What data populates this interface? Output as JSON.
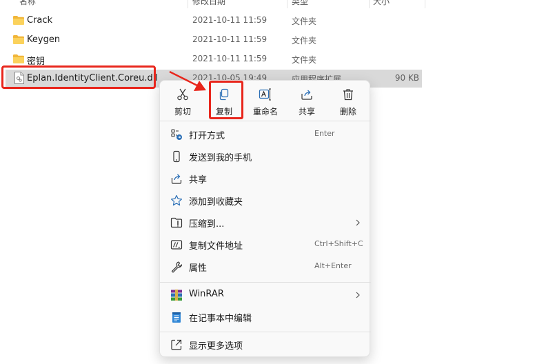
{
  "columns": {
    "name": "名称",
    "date": "修改日期",
    "type": "类型",
    "size": "大小"
  },
  "files": [
    {
      "name": "Crack",
      "date": "2021-10-11 11:59",
      "type": "文件夹",
      "size": "",
      "kind": "folder"
    },
    {
      "name": "Keygen",
      "date": "2021-10-11 11:59",
      "type": "文件夹",
      "size": "",
      "kind": "folder"
    },
    {
      "name": "密钥",
      "date": "2021-10-11 11:59",
      "type": "文件夹",
      "size": "",
      "kind": "folder"
    },
    {
      "name": "Eplan.IdentityClient.Coreu.dll",
      "date": "2021-10-05 19:49",
      "type": "应用程序扩展",
      "size": "90 KB",
      "kind": "dll",
      "selected": true
    }
  ],
  "context_menu": {
    "quick_actions": [
      {
        "label": "剪切",
        "icon": "scissors-icon"
      },
      {
        "label": "复制",
        "icon": "copy-icon"
      },
      {
        "label": "重命名",
        "icon": "rename-icon"
      },
      {
        "label": "共享",
        "icon": "share-icon"
      },
      {
        "label": "删除",
        "icon": "trash-icon"
      }
    ],
    "items": [
      {
        "label": "打开方式",
        "shortcut": "Enter",
        "icon": "open-with-icon"
      },
      {
        "label": "发送到我的手机",
        "shortcut": "",
        "icon": "phone-icon"
      },
      {
        "label": "共享",
        "shortcut": "",
        "icon": "share-icon"
      },
      {
        "label": "添加到收藏夹",
        "shortcut": "",
        "icon": "star-icon"
      },
      {
        "label": "压缩到...",
        "shortcut": "",
        "icon": "zip-folder-icon",
        "submenu": true
      },
      {
        "label": "复制文件地址",
        "shortcut": "Ctrl+Shift+C",
        "icon": "copy-path-icon"
      },
      {
        "label": "属性",
        "shortcut": "Alt+Enter",
        "icon": "wrench-icon"
      },
      {
        "label": "WinRAR",
        "shortcut": "",
        "icon": "winrar-icon",
        "submenu": true
      },
      {
        "label": "在记事本中编辑",
        "shortcut": "",
        "icon": "notepad-icon"
      },
      {
        "label": "显示更多选项",
        "shortcut": "",
        "icon": "show-more-icon"
      }
    ]
  },
  "colors": {
    "highlight_red": "#e8261c",
    "selection_gray": "#d9d9d9",
    "folder_yellow": "#f8c93e",
    "accent_blue": "#2b6fb6"
  }
}
